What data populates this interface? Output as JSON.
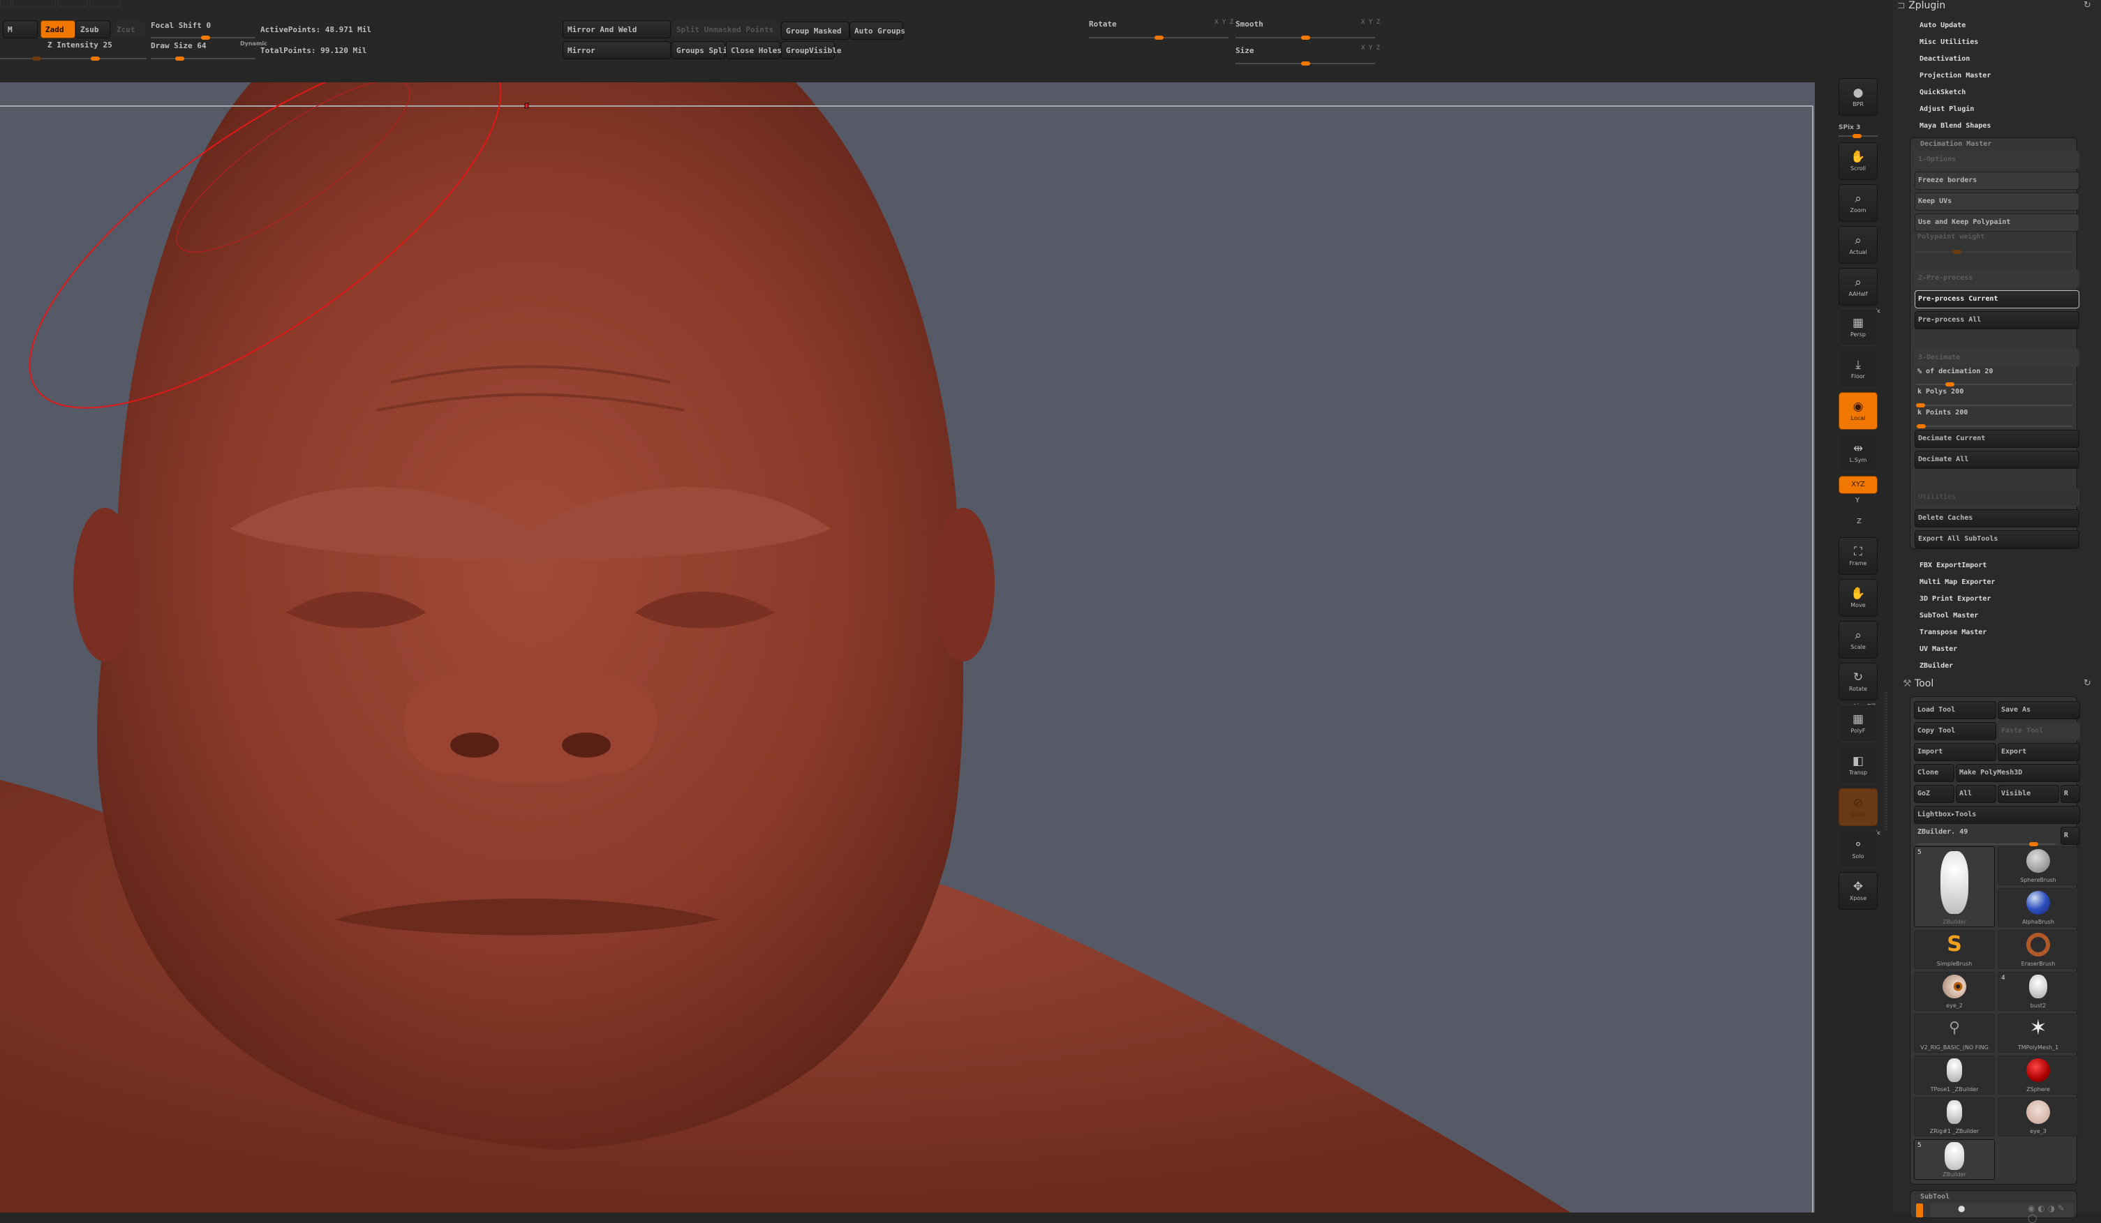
{
  "colors": {
    "accent": "#f07800",
    "canvas": "#565a66",
    "panel": "#2a2a2a",
    "clay": "#8a3a2c",
    "cursor": "#e01818"
  },
  "toolbar": {
    "m_label": "M",
    "zadd_label": "Zadd",
    "zsub_label": "Zsub",
    "zcut_label": "Zcut",
    "z_intensity_label": "Z Intensity 25",
    "z_intensity_value": 25,
    "focal_shift_label": "Focal Shift 0",
    "focal_shift_value": 0,
    "draw_size_label": "Draw Size 64",
    "draw_size_value": 64,
    "dynamic_label": "Dynamic",
    "active_points": "ActivePoints: 48.971 Mil",
    "total_points": "TotalPoints: 99.120 Mil",
    "mirror_and_weld": "Mirror And Weld",
    "mirror": "Mirror",
    "split_unmasked_points": "Split Unmasked Points",
    "groups_split": "Groups Split",
    "close_holes": "Close Holes",
    "group_masked": "Group Masked",
    "auto_groups": "Auto Groups",
    "group_visible": "GroupVisible",
    "rotate_label": "Rotate",
    "smooth_label": "Smooth",
    "size_label": "Size",
    "xyz_label": "X Y Z"
  },
  "shelf": {
    "bpr": "BPR",
    "spix_label": "SPix 3",
    "spix_value": 3,
    "scroll": "Scroll",
    "zoom": "Zoom",
    "actual": "Actual",
    "aahalf": "AAHalf",
    "dynamic": "Dynamic",
    "persp": "Persp",
    "floor": "Floor",
    "local": "Local",
    "lsym": "L.Sym",
    "xyz": "XYZ",
    "y": "Y",
    "z": "Z",
    "frame": "Frame",
    "move": "Move",
    "scale": "Scale",
    "rotate": "Rotate",
    "line_fill": "Line Fill",
    "polyf": "PolyF",
    "transp": "Transp",
    "ghost": "Ghost",
    "solo": "Solo",
    "xpose": "Xpose"
  },
  "zplugin": {
    "title": "Zplugin",
    "items": [
      "Auto Update",
      "Misc Utilities",
      "Deactivation",
      "Projection Master",
      "QuickSketch",
      "Adjust Plugin",
      "Maya Blend Shapes"
    ],
    "decimation_master": {
      "title": "Decimation Master",
      "options_header": "1-Options",
      "freeze_borders": "Freeze borders",
      "keep_uvs": "Keep UVs",
      "use_keep_polypaint": "Use and Keep Polypaint",
      "polypaint_weight": "Polypaint weight",
      "preprocess_header": "2-Pre-process",
      "preprocess_current": "Pre-process Current",
      "preprocess_all": "Pre-process All",
      "decimate_header": "3-Decimate",
      "pct_decimation_label": "% of decimation 20",
      "pct_decimation_value": 20,
      "k_polys_label": "k Polys 200",
      "k_polys_value": 200,
      "k_points_label": "k Points 200",
      "k_points_value": 200,
      "decimate_current": "Decimate Current",
      "decimate_all": "Decimate All",
      "utilities_header": "Utilities",
      "delete_caches": "Delete Caches",
      "export_all_subtools": "Export All SubTools"
    },
    "items_after": [
      "FBX ExportImport",
      "Multi Map Exporter",
      "3D Print Exporter",
      "SubTool Master",
      "Transpose Master",
      "UV Master",
      "ZBuilder"
    ]
  },
  "tool": {
    "title": "Tool",
    "load_tool": "Load Tool",
    "save_as": "Save As",
    "copy_tool": "Copy Tool",
    "paste_tool": "Paste Tool",
    "import": "Import",
    "export": "Export",
    "clone": "Clone",
    "make_polymesh": "Make PolyMesh3D",
    "goz": "GoZ",
    "all": "All",
    "visible": "Visible",
    "r": "R",
    "lightbox_tools": "Lightbox▸Tools",
    "current_tool_label": "ZBuilder. 49",
    "current_tool_value": 49,
    "thumbnails": [
      {
        "name": "ZBuilder",
        "badge": "5"
      },
      {
        "name": "SphereBrush",
        "badge": ""
      },
      {
        "name": "AlphaBrush",
        "badge": ""
      },
      {
        "name": "SimpleBrush",
        "badge": ""
      },
      {
        "name": "EraserBrush",
        "badge": ""
      },
      {
        "name": "eye_2",
        "badge": ""
      },
      {
        "name": "bust2",
        "badge": "4"
      },
      {
        "name": "V2_RIG_BASIC_(NO FING",
        "badge": ""
      },
      {
        "name": "TMPolyMesh_1",
        "badge": ""
      },
      {
        "name": "TPose1 _ZBuilder",
        "badge": ""
      },
      {
        "name": "ZSphere",
        "badge": ""
      },
      {
        "name": "ZRig#1 _ZBuilder",
        "badge": ""
      },
      {
        "name": "eye_3",
        "badge": ""
      },
      {
        "name": "ZBuilder",
        "badge": "5"
      }
    ]
  },
  "subtool": {
    "title": "SubTool"
  }
}
